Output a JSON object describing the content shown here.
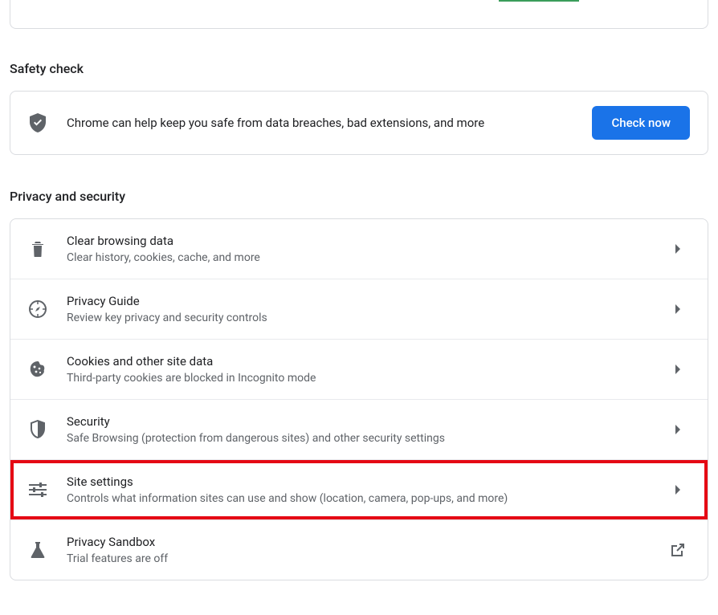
{
  "safety": {
    "heading": "Safety check",
    "description": "Chrome can help keep you safe from data breaches, bad extensions, and more",
    "button": "Check now"
  },
  "privacy": {
    "heading": "Privacy and security",
    "items": [
      {
        "title": "Clear browsing data",
        "sub": "Clear history, cookies, cache, and more"
      },
      {
        "title": "Privacy Guide",
        "sub": "Review key privacy and security controls"
      },
      {
        "title": "Cookies and other site data",
        "sub": "Third-party cookies are blocked in Incognito mode"
      },
      {
        "title": "Security",
        "sub": "Safe Browsing (protection from dangerous sites) and other security settings"
      },
      {
        "title": "Site settings",
        "sub": "Controls what information sites can use and show (location, camera, pop-ups, and more)"
      },
      {
        "title": "Privacy Sandbox",
        "sub": "Trial features are off"
      }
    ]
  }
}
